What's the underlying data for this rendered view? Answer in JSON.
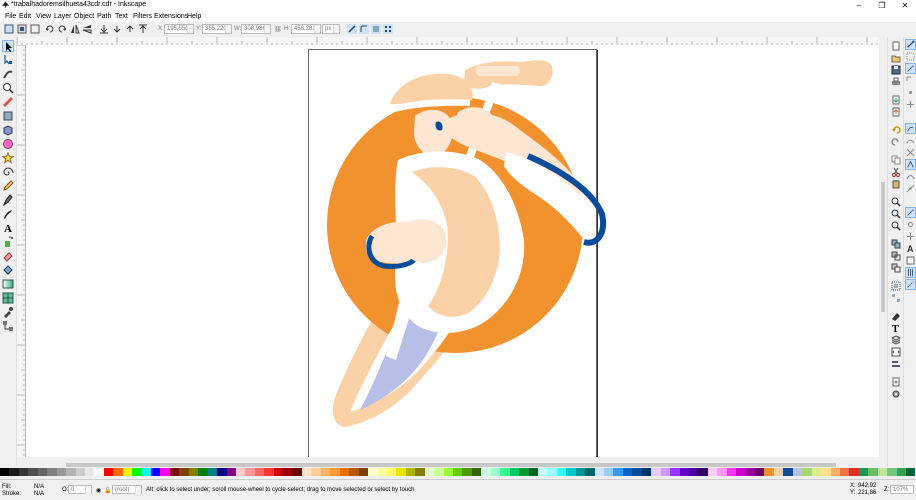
{
  "window": {
    "title": "*trabalhadoremsilhueta43cdr.cdr - Inkscape",
    "minimize": "–",
    "maximize": "❐",
    "close": "✕"
  },
  "menu": [
    "File",
    "Edit",
    "View",
    "Layer",
    "Object",
    "Path",
    "Text",
    "Filters",
    "Extensions",
    "Help"
  ],
  "controls": {
    "x_label": "X:",
    "x_value": "195,550",
    "y_label": "Y:",
    "y_value": "355,220",
    "w_label": "W:",
    "w_value": "308,986",
    "h_label": "H:",
    "h_value": "458,281",
    "unit": "px"
  },
  "status": {
    "fill_label": "Fill:",
    "fill_value": "N/A",
    "stroke_label": "Stroke:",
    "stroke_value": "N/A",
    "opacity_label": "O:",
    "opacity_value": "0",
    "layer": "(root)",
    "message": "Alt: click to select under; scroll mouse-wheel to cycle-select; drag to move selected or select by touch",
    "coord_x_label": "X:",
    "coord_x": "942,92",
    "coord_y_label": "Y:",
    "coord_y": "221,86",
    "zoom_label": "Z:",
    "zoom": "107%"
  },
  "colors": {
    "orange": "#f2922f",
    "peach": "#fbd2a8",
    "cream": "#fde6d2",
    "blue": "#0b4c9a",
    "lavender": "#b8bfe6",
    "white": "#ffffff"
  },
  "palette": [
    "#000000",
    "#1a1a1a",
    "#333333",
    "#4d4d4d",
    "#666666",
    "#808080",
    "#999999",
    "#b3b3b3",
    "#cccccc",
    "#e6e6e6",
    "#ffffff",
    "#ff0000",
    "#ff6600",
    "#ffff00",
    "#00ff00",
    "#00ffff",
    "#0000ff",
    "#ff00ff",
    "#800000",
    "#804000",
    "#808000",
    "#008000",
    "#008080",
    "#000080",
    "#800080",
    "#ffcccc",
    "#ff9999",
    "#ff6666",
    "#ff3333",
    "#cc0000",
    "#990000",
    "#660000",
    "#ffe5cc",
    "#ffcc99",
    "#ffb366",
    "#ff9933",
    "#e67300",
    "#b35900",
    "#804000",
    "#ffffcc",
    "#ffff99",
    "#ffff66",
    "#e6e600",
    "#b3b300",
    "#808000",
    "#e5ffcc",
    "#ccff99",
    "#99ff33",
    "#66cc00",
    "#4d9900",
    "#336600",
    "#ccffe5",
    "#99ffcc",
    "#33ff99",
    "#00cc66",
    "#009933",
    "#006622",
    "#ccffff",
    "#99ffff",
    "#33ffff",
    "#00cccc",
    "#009999",
    "#006666",
    "#cce5ff",
    "#99ccff",
    "#3399ff",
    "#0066cc",
    "#004c99",
    "#003366",
    "#e5ccff",
    "#cc99ff",
    "#9933ff",
    "#6600cc",
    "#4c0099",
    "#330066",
    "#ffccff",
    "#ff99ff",
    "#ff33ff",
    "#cc00cc",
    "#990099",
    "#660066",
    "#f2922f",
    "#fbd2a8",
    "#0b4c9a",
    "#b8bfe6",
    "#a6d96a",
    "#d9ef8b",
    "#fee08b",
    "#fdae61",
    "#f46d43",
    "#d73027",
    "#1a9850",
    "#66bd63",
    "#c2e699",
    "#78c679",
    "#31a354",
    "#006837"
  ]
}
